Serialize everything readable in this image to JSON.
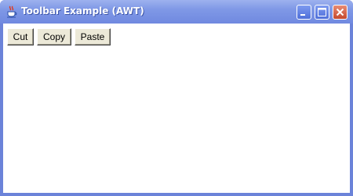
{
  "window": {
    "title": "Toolbar Example (AWT)",
    "app_icon": "java-coffee-cup-icon",
    "controls": [
      "minimize-icon",
      "maximize-icon",
      "close-icon"
    ]
  },
  "toolbar": {
    "buttons": [
      {
        "label": "Cut"
      },
      {
        "label": "Copy"
      },
      {
        "label": "Paste"
      }
    ]
  },
  "colors": {
    "titlebar": "#7089e0",
    "close_button": "#c4492d",
    "button_face": "#ece9d8",
    "client_background": "#ffffff"
  }
}
